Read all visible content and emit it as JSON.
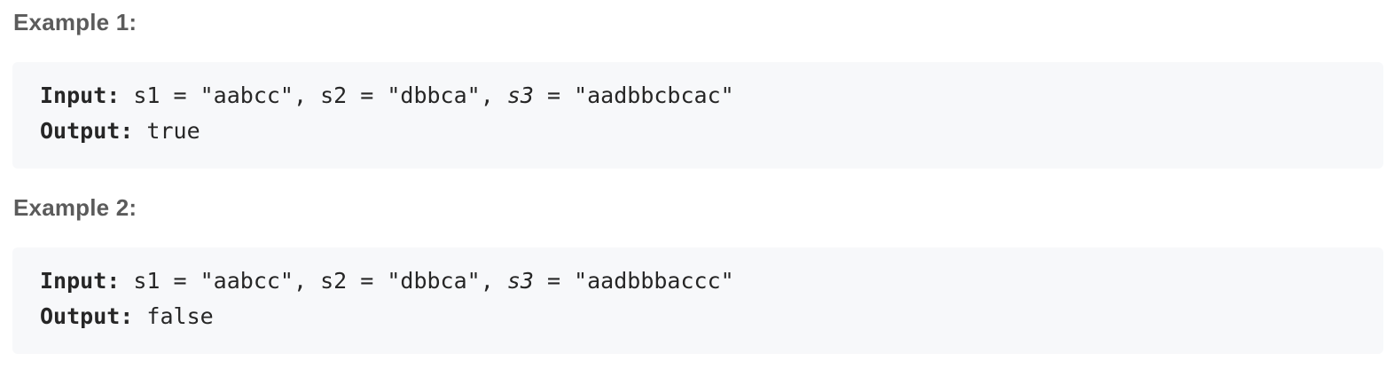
{
  "examples": [
    {
      "heading": "Example 1:",
      "input_label": "Input:",
      "input_part1": " s1 = \"aabcc\", s2 = \"dbbca\", ",
      "input_s3": "s3",
      "input_part2": " = \"aadbbcbcac\"",
      "output_label": "Output:",
      "output_value": " true"
    },
    {
      "heading": "Example 2:",
      "input_label": "Input:",
      "input_part1": " s1 = \"aabcc\", s2 = \"dbbca\", ",
      "input_s3": "s3",
      "input_part2": " = \"aadbbbaccc\"",
      "output_label": "Output:",
      "output_value": " false"
    }
  ]
}
